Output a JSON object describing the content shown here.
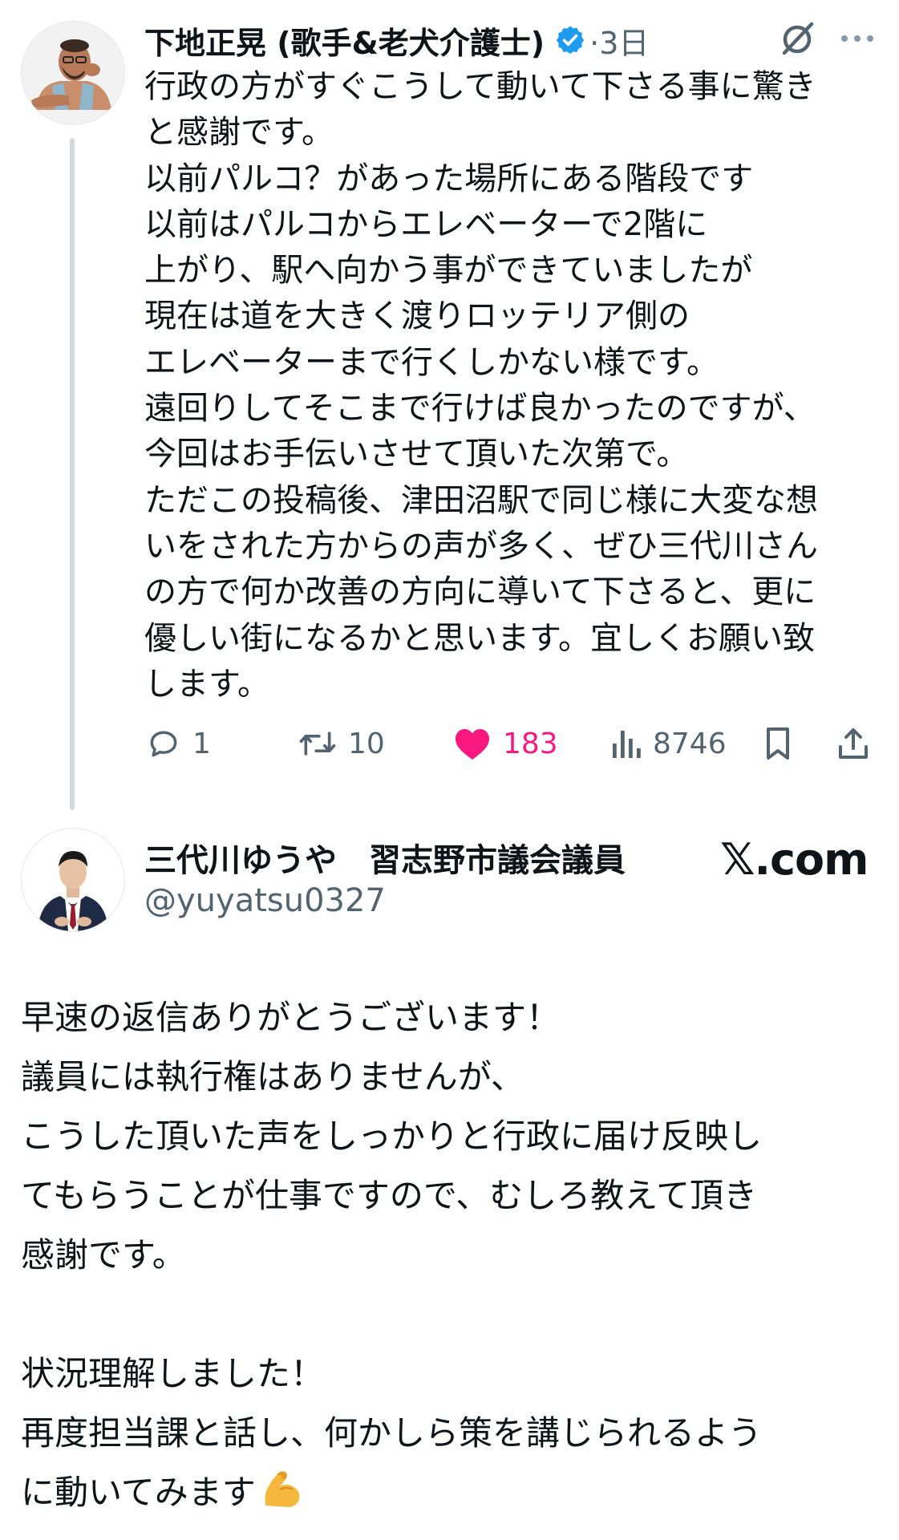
{
  "tweet": {
    "author_name": "下地正晃 (歌手&老犬介護士)",
    "time": "·3日",
    "body_lines": [
      "行政の方がすぐこうして動いて下さる事に驚き",
      "と感謝です。",
      "以前パルコ？があった場所にある階段です",
      "以前はパルコからエレベーターで2階に",
      "上がり、駅へ向かう事ができていましたが",
      "現在は道を大きく渡りロッテリア側の",
      "エレベーターまで行くしかない様です。",
      "遠回りしてそこまで行けば良かったのですが、",
      "今回はお手伝いさせて頂いた次第で。",
      "ただこの投稿後、津田沼駅で同じ様に大変な想",
      "いをされた方からの声が多く、ぜひ三代川さん",
      "の方で何か改善の方向に導いて下さると、更に",
      "優しい街になるかと思います。宜しくお願い致",
      "します。"
    ],
    "actions": {
      "replies": "1",
      "retweets": "10",
      "likes": "183",
      "views": "8746"
    },
    "icons": {
      "verified": "verified-badge-icon",
      "grok": "grok-icon",
      "more": "more-icon",
      "reply": "reply-icon",
      "retweet": "retweet-icon",
      "like": "heart-icon",
      "views": "views-icon",
      "bookmark": "bookmark-icon",
      "share": "share-icon"
    },
    "colors": {
      "verified": "#1d9bf0",
      "like": "#f91880",
      "muted": "#536471"
    }
  },
  "reply": {
    "author_name": "三代川ゆうや　習志野市議会議員",
    "handle": "@yuyatsu0327",
    "watermark": "𝕏.com",
    "body_paragraph1": [
      "早速の返信ありがとうございます！",
      "議員には執行権はありませんが、",
      "こうした頂いた声をしっかりと行政に届け反映し",
      "てもらうことが仕事ですので、むしろ教えて頂き",
      "感謝です。"
    ],
    "body_paragraph2": [
      "状況理解しました！",
      "再度担当課と話し、何かしら策を講じられるよう",
      "に動いてみます"
    ],
    "emoji": "flexed-biceps-icon"
  }
}
